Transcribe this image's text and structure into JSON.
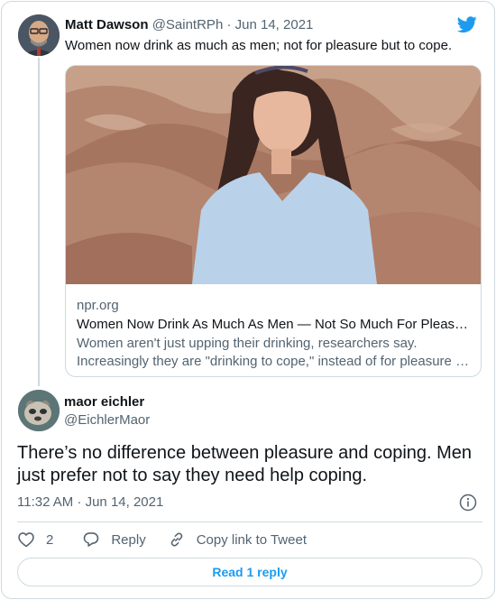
{
  "colors": {
    "accent": "#1d9bf0",
    "text": "#0f1419",
    "muted": "#536471",
    "border": "#cfd9de"
  },
  "parent_tweet": {
    "name": "Matt Dawson",
    "handle": "@SaintRPh",
    "separator": "·",
    "date": "Jun 14, 2021",
    "text": "Women now drink as much as men; not for pleasure but to cope.",
    "link_card": {
      "domain": "npr.org",
      "title": "Women Now Drink As Much As Men — Not So Much For Pleasure",
      "description_line1": "Women aren't just upping their drinking, researchers say.",
      "description_line2": "Increasingly they are \"drinking to cope,\" instead of for pleasure or socializing."
    }
  },
  "reply_tweet": {
    "name": "maor eichler",
    "handle": "@EichlerMaor",
    "text": "There’s no difference between pleasure and coping. Men just prefer not to say they need help coping.",
    "timestamp": "11:32 AM · Jun 14, 2021"
  },
  "actions": {
    "like_count": "2",
    "reply_label": "Reply",
    "copy_label": "Copy link to Tweet"
  },
  "read_replies_label": "Read 1 reply",
  "icons": {
    "brand": "twitter-bird-icon",
    "info": "info-icon",
    "like": "heart-icon",
    "reply": "speech-bubble-icon",
    "copy": "link-icon"
  }
}
